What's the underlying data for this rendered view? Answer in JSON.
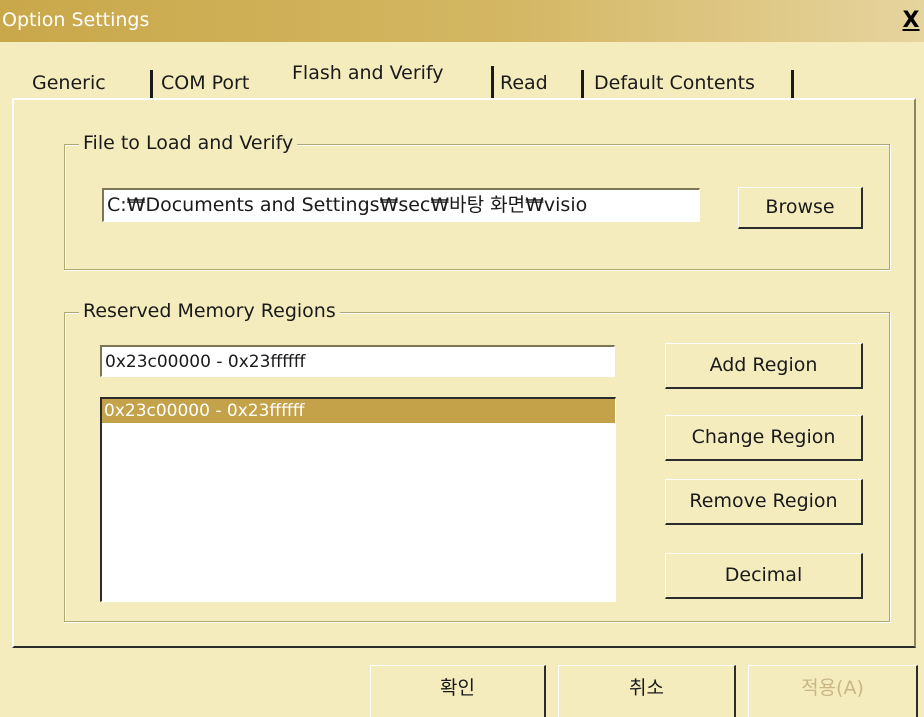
{
  "window": {
    "title": "Option Settings",
    "close_label": "X"
  },
  "tabs": [
    {
      "label": "Generic"
    },
    {
      "label": "COM Port"
    },
    {
      "label": "Flash and Verify",
      "active": true
    },
    {
      "label": "Read"
    },
    {
      "label": "Default Contents"
    }
  ],
  "file_group": {
    "label": "File to Load and Verify",
    "path_value": "C:₩Documents and Settings₩sec₩바탕 화면₩visio",
    "browse_label": "Browse"
  },
  "memory_group": {
    "label": "Reserved Memory Regions",
    "region_input_value": "0x23c00000 - 0x23ffffff",
    "regions": [
      "0x23c00000 - 0x23ffffff"
    ],
    "add_label": "Add Region",
    "change_label": "Change Region",
    "remove_label": "Remove Region",
    "decimal_label": "Decimal"
  },
  "footer": {
    "ok_label": "확인",
    "cancel_label": "취소",
    "apply_label": "적용(A)"
  },
  "colors": {
    "face": "#f5ecbe",
    "title_gradient_start": "#c9a84a",
    "selection": "#c3a24a",
    "disabled_text": "#c8b782"
  }
}
